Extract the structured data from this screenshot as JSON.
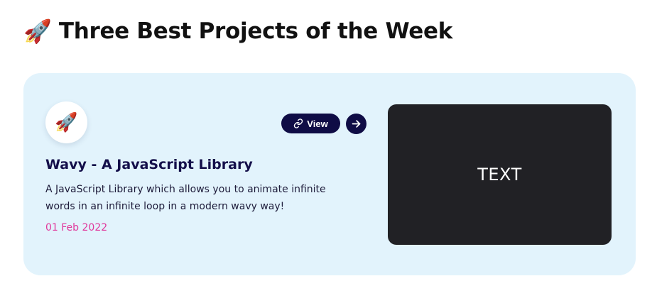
{
  "header": {
    "icon": "rocket-emoji",
    "icon_glyph": "🚀",
    "title": "Three Best Projects of the Week"
  },
  "project": {
    "avatar_icon": "rocket-emoji",
    "avatar_glyph": "🚀",
    "view_label": "View",
    "view_icon": "link-icon",
    "next_icon": "arrow-right-icon",
    "title": "Wavy - A JavaScript Library",
    "description": "A JavaScript Library which allows you to animate infinite words in an infinite loop in a modern wavy way!",
    "date": "01 Feb 2022",
    "preview_text": "TEXT"
  },
  "colors": {
    "card_background": "#e2f3fc",
    "button_background": "#0f0c45",
    "title_color": "#140f4a",
    "date_color": "#e0379b",
    "preview_background": "#212125"
  }
}
